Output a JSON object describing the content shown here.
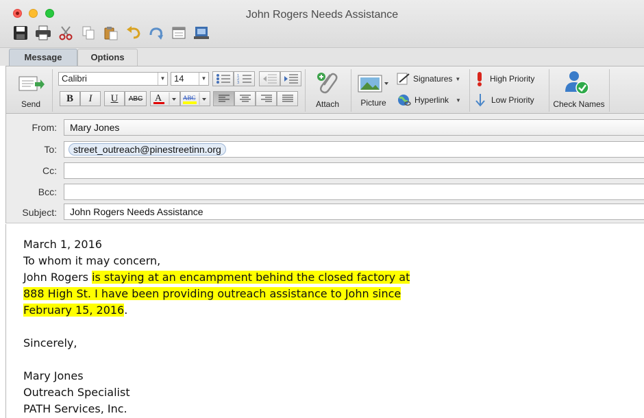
{
  "window": {
    "title": "John Rogers Needs Assistance"
  },
  "quick_toolbar": [
    {
      "icon": "save-icon"
    },
    {
      "icon": "print-icon"
    },
    {
      "icon": "cut-icon"
    },
    {
      "icon": "copy-icon"
    },
    {
      "icon": "paste-icon"
    },
    {
      "icon": "undo-icon"
    },
    {
      "icon": "redo-icon"
    },
    {
      "icon": "window-icon"
    },
    {
      "icon": "send-receive-icon"
    }
  ],
  "tabs": {
    "message": "Message",
    "options": "Options"
  },
  "ribbon": {
    "send": "Send",
    "font_name": "Calibri",
    "font_size": "14",
    "bold": "B",
    "italic": "I",
    "underline": "U",
    "strike": "ABC",
    "attach": "Attach",
    "picture": "Picture",
    "signatures": "Signatures",
    "hyperlink": "Hyperlink",
    "high_priority": "High Priority",
    "low_priority": "Low Priority",
    "check_names": "Check Names",
    "colors": {
      "font_color": "#e00000",
      "highlight_color": "#ffff00",
      "priority_red": "#d9261c"
    }
  },
  "headers": {
    "from_label": "From:",
    "from_value": "Mary Jones",
    "to_label": "To:",
    "to_value": "street_outreach@pinestreetinn.org",
    "cc_label": "Cc:",
    "cc_value": "",
    "bcc_label": "Bcc:",
    "bcc_value": "",
    "subject_label": "Subject:",
    "subject_value": "John Rogers Needs Assistance"
  },
  "body": {
    "date": "March 1, 2016",
    "greeting": "To whom it may concern,",
    "p1_a": "John Rogers ",
    "p1_b": "is staying at an encampment behind the closed factory at",
    "p2": "888 High St. I have been providing outreach assistance to John since",
    "p3_a": "February 15, 2016",
    "p3_b": ".",
    "closing": "Sincerely,",
    "sig_name": "Mary Jones",
    "sig_title": "Outreach Specialist",
    "sig_org": "PATH Services, Inc."
  }
}
